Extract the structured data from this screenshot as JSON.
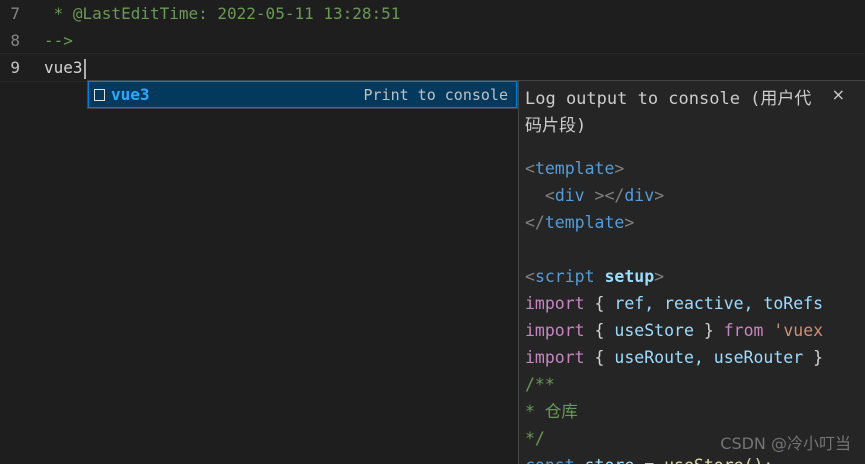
{
  "editor": {
    "lines": [
      {
        "number": "7",
        "text": " * @LastEditTime: 2022-05-11 13:28:51"
      },
      {
        "number": "8",
        "text": "-->"
      },
      {
        "number": "9",
        "text": "vue3"
      }
    ]
  },
  "suggest": {
    "label": "vue3",
    "detail": "Print to console",
    "icon": "snippet-icon"
  },
  "details": {
    "title": "Log output to console (用户代码片段)",
    "close": "×",
    "snippet": {
      "l1_open": "<",
      "l1_tag": "template",
      "l1_close": ">",
      "l2_indent": "  ",
      "l2_open": "<",
      "l2_tag": "div",
      "l2_mid": " ></",
      "l2_tag2": "div",
      "l2_close": ">",
      "l3_open": "</",
      "l3_tag": "template",
      "l3_close": ">",
      "l5_open": "<",
      "l5_tag": "script",
      "l5_attr": "setup",
      "l5_close": ">",
      "l6_kw": "import",
      "l6_rest": " { ",
      "l6_ids": "ref, reactive, toRefs",
      "l7_kw": "import",
      "l7_rest": " { ",
      "l7_id": "useStore",
      "l7_mid": " } ",
      "l7_from": "from",
      "l7_str": " 'vuex",
      "l8_kw": "import",
      "l8_rest": " { ",
      "l8_ids": "useRoute, useRouter",
      "l8_end": " }",
      "l9": "/**",
      "l10": "* 仓库",
      "l11": "*/",
      "l12_kw": "const",
      "l12_id": " store",
      "l12_rest": " = ",
      "l12_fn": "useStore();"
    }
  },
  "watermark": "CSDN @冷小叮当",
  "colors": {
    "background": "#1e1e1e",
    "suggest_selected": "#04395e",
    "suggest_label": "#2aaaff",
    "comment": "#6a9955"
  }
}
